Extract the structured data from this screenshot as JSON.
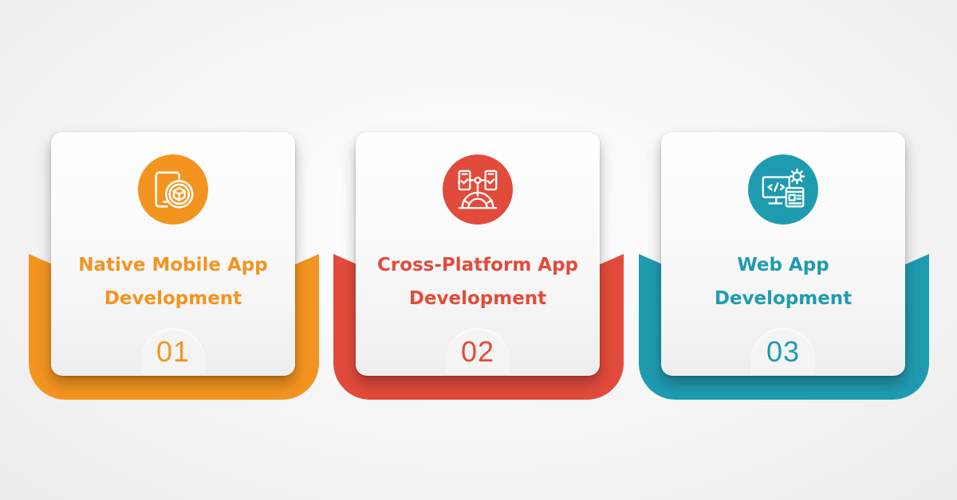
{
  "colors": {
    "orange": "#f39420",
    "red": "#e24b3b",
    "teal": "#1f9bb0",
    "card_background": "#f7f7f7"
  },
  "services": [
    {
      "title_line1": "Native Mobile App",
      "title_line2": "Development",
      "number": "01",
      "icon": "mobile-cube-icon",
      "color": "#f39420"
    },
    {
      "title_line1": "Cross-Platform App",
      "title_line2": "Development",
      "number": "02",
      "icon": "cross-platform-sync-icon",
      "color": "#e24b3b"
    },
    {
      "title_line1": "Web App",
      "title_line2": "Development",
      "number": "03",
      "icon": "web-code-gear-icon",
      "color": "#1f9bb0"
    }
  ]
}
